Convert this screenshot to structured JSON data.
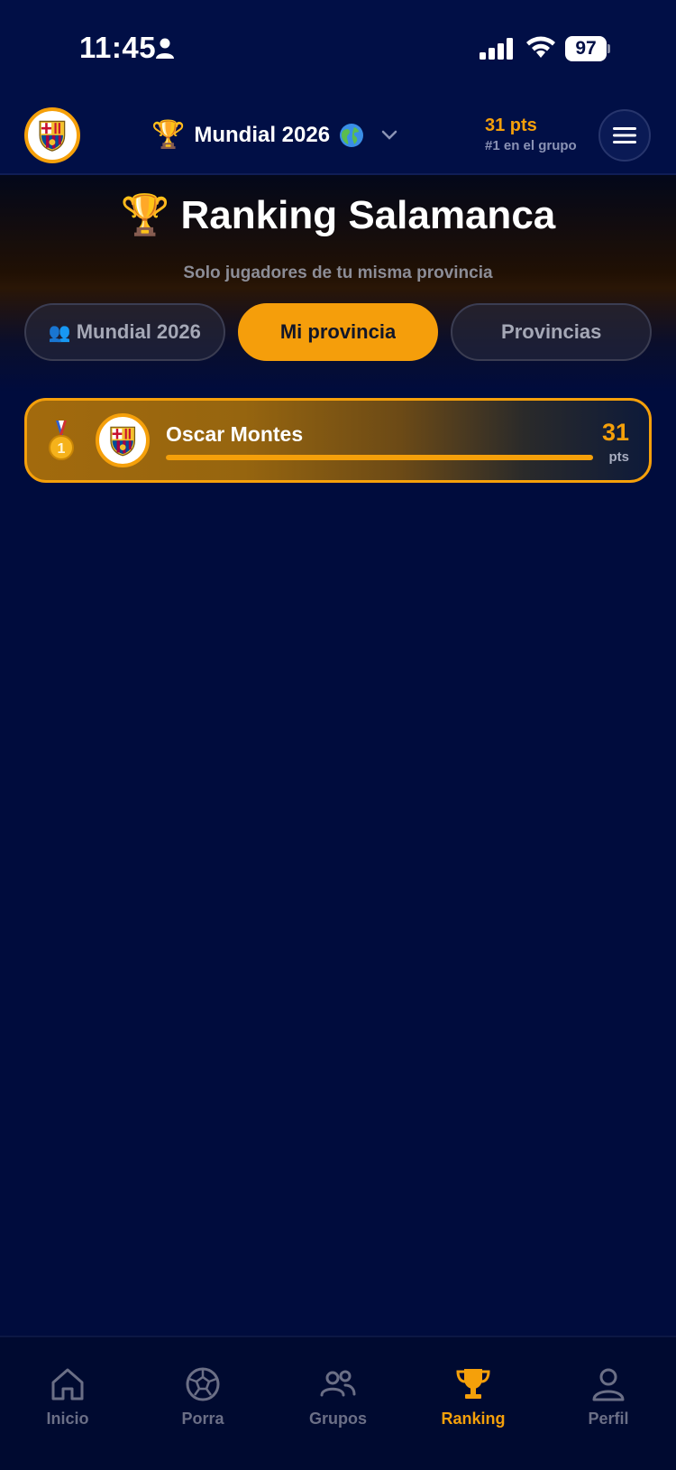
{
  "status_bar": {
    "time": "11:45",
    "battery": "97"
  },
  "header": {
    "competition_trophy": "🏆",
    "competition_name": "Mundial 2026",
    "points": "31 pts",
    "rank": "#1 en el grupo"
  },
  "hero": {
    "trophy": "🏆",
    "title": "Ranking Salamanca",
    "subtitle": "Solo jugadores de tu misma provincia"
  },
  "tabs": [
    {
      "icon": "👥",
      "label": "Mundial 2026",
      "active": false
    },
    {
      "label": "Mi provincia",
      "active": true
    },
    {
      "label": "Provincias",
      "active": false
    }
  ],
  "ranking": [
    {
      "position": 1,
      "name": "Oscar Montes",
      "points": "31",
      "unit": "pts",
      "progress": 1.0
    }
  ],
  "nav": [
    {
      "label": "Inicio",
      "icon": "home-icon"
    },
    {
      "label": "Porra",
      "icon": "soccer-ball-icon"
    },
    {
      "label": "Grupos",
      "icon": "users-icon"
    },
    {
      "label": "Ranking",
      "icon": "trophy-icon",
      "active": true
    },
    {
      "label": "Perfil",
      "icon": "user-icon"
    }
  ],
  "colors": {
    "accent": "#f5a00a",
    "background": "#000c3d",
    "inactive": "#6b6f86"
  }
}
